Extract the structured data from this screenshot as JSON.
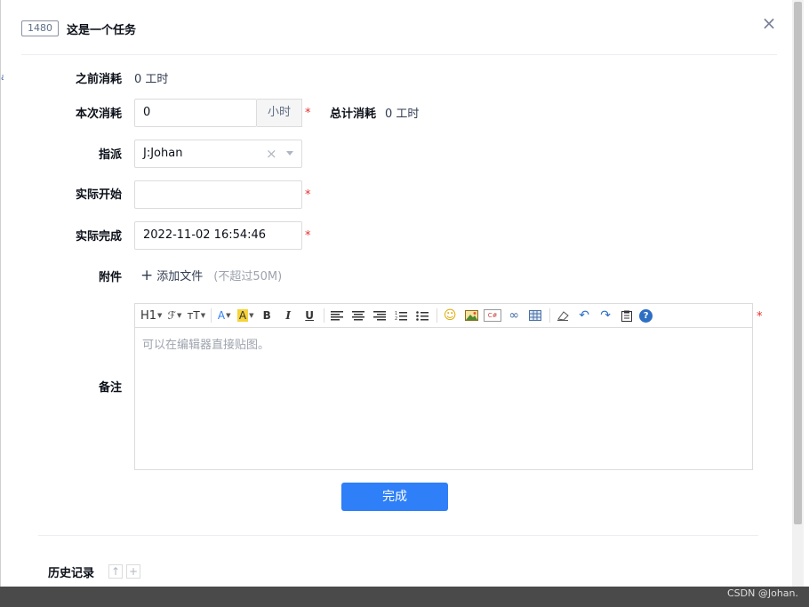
{
  "header": {
    "id": "1480",
    "title": "这是一个任务",
    "close_icon": "×"
  },
  "fields": {
    "before_cost": {
      "label": "之前消耗",
      "value": "0 工时"
    },
    "this_cost": {
      "label": "本次消耗",
      "value": "0",
      "unit": "小时",
      "required": "*"
    },
    "total_cost": {
      "label": "总计消耗",
      "value": "0 工时"
    },
    "assign": {
      "label": "指派",
      "value": "J:Johan",
      "clear": "×"
    },
    "actual_start": {
      "label": "实际开始",
      "value": "",
      "required": "*"
    },
    "actual_finish": {
      "label": "实际完成",
      "value": "2022-11-02 16:54:46",
      "required": "*"
    },
    "attachment": {
      "label": "附件",
      "add_label": "添加文件",
      "limit": "(不超过50M)"
    },
    "remark": {
      "label": "备注",
      "placeholder": "可以在编辑器直接贴图。",
      "required": "*"
    }
  },
  "toolbar": {
    "heading": "H1",
    "font": "ℱ",
    "size": "тT",
    "font_color": "A",
    "bg_color": "A",
    "bold": "B",
    "italic": "I",
    "underline": "U",
    "emoji": "☺",
    "code": "C#",
    "link": "∞",
    "help": "?"
  },
  "submit_label": "完成",
  "history": {
    "label": "历史记录"
  },
  "watermark": "CSDN @Johan."
}
